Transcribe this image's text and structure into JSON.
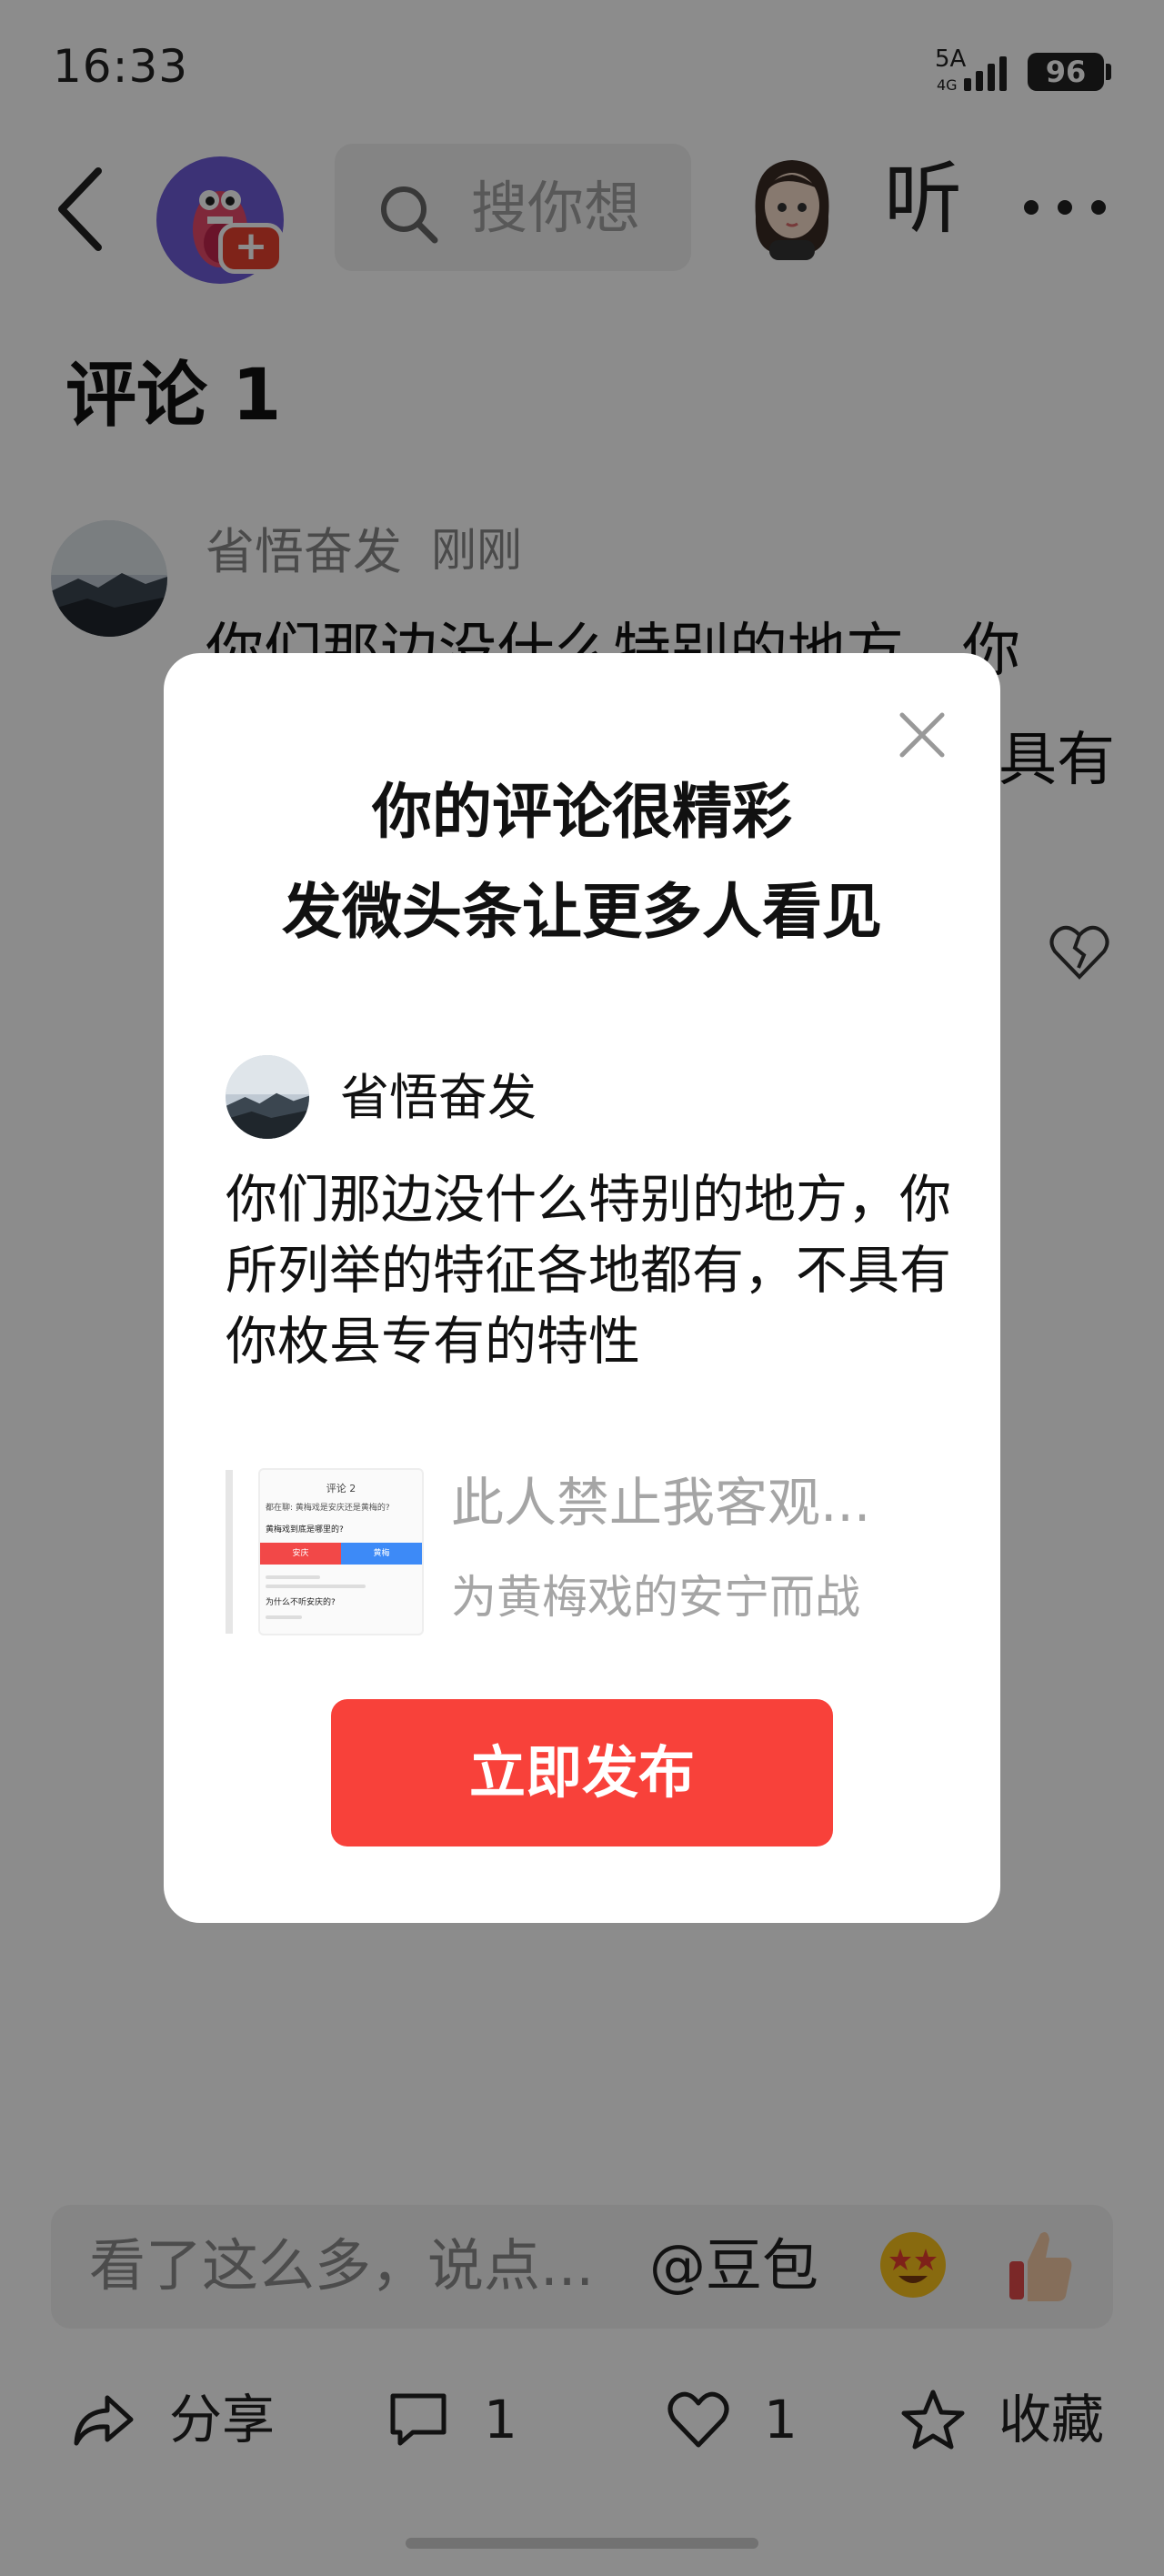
{
  "status_bar": {
    "time": "16:33",
    "network": "5A",
    "network_sub": "4G",
    "battery": "96"
  },
  "nav": {
    "search_placeholder": "搜你想",
    "listen_label": "听",
    "icons": [
      "back-icon",
      "app-logo",
      "search-icon",
      "avatar-girl",
      "more-icon"
    ]
  },
  "comments_header": {
    "title": "评论 1"
  },
  "comment": {
    "author": "省悟奋发",
    "time": "刚刚",
    "line1": "你们那边没什么特别的地方，你",
    "line2": "具有"
  },
  "bottom_input": {
    "placeholder": "看了这么多，说点...",
    "at_label": "@豆包"
  },
  "actions": {
    "share": "分享",
    "comment_count": "1",
    "like_count": "1",
    "favorite": "收藏"
  },
  "modal": {
    "title_line1": "你的评论很精彩",
    "title_line2": "发微头条让更多人看见",
    "username": "省悟奋发",
    "comment_text": "你们那边没什么特别的地方，你所列举的特征各地都有，不具有你枚县专有的特性",
    "linked_title": "此人禁止我客观...",
    "linked_subtitle": "为黄梅戏的安宁而战",
    "publish_button": "立即发布",
    "thumbnail": {
      "title": "评论 2",
      "question": "都在聊: 黄梅戏是安庆还是黄梅的?",
      "prompt": "黄梅戏到底是哪里的?",
      "option_left": "安庆",
      "option_right": "黄梅",
      "answer": "为什么不听安庆的?"
    }
  },
  "colors": {
    "accent_red": "#f8413a",
    "logo_purple": "#6d5bd8"
  }
}
